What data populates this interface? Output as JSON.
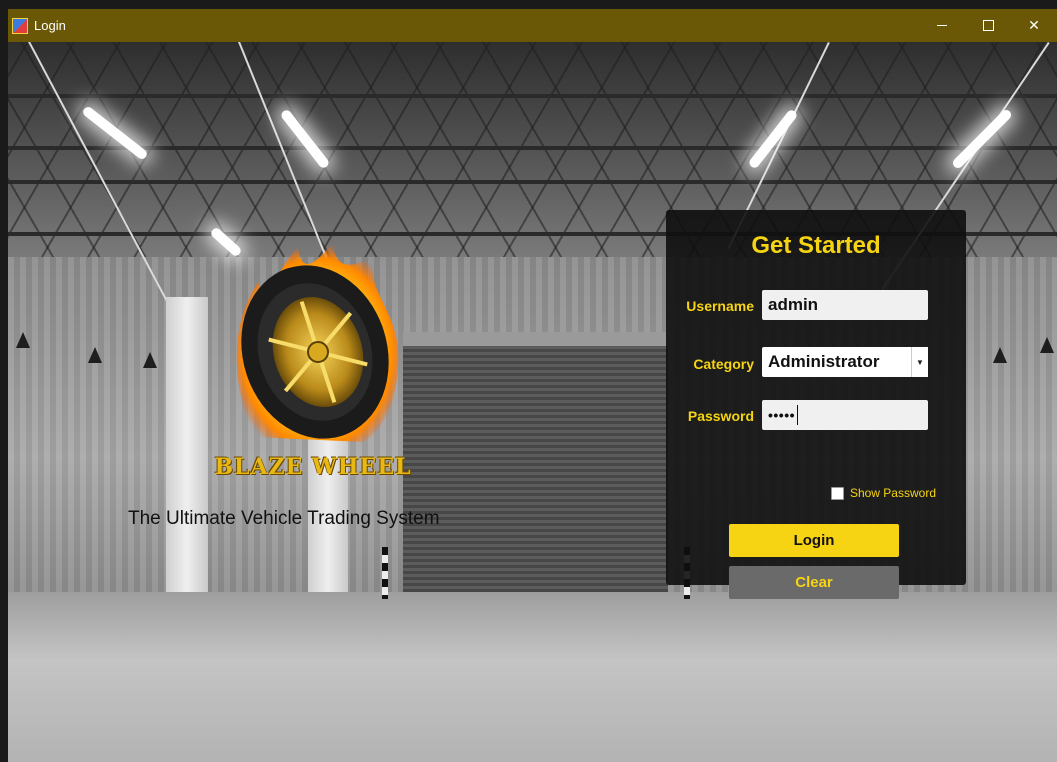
{
  "window": {
    "title": "Login",
    "controls": {
      "minimize": "minimize-icon",
      "maximize": "maximize-icon",
      "close": "close-icon"
    }
  },
  "brand": {
    "name": "BLAZE WHEEL",
    "tagline": "The Ultimate Vehicle Trading System"
  },
  "login": {
    "heading": "Get Started",
    "username_label": "Username",
    "username_value": "admin",
    "category_label": "Category",
    "category_value": "Administrator",
    "password_label": "Password",
    "password_mask": "•••••",
    "show_password_label": "Show Password",
    "show_password_checked": false,
    "login_button": "Login",
    "clear_button": "Clear"
  },
  "colors": {
    "titlebar": "#6b5806",
    "accent": "#f6d413",
    "panel": "#0e0e0e",
    "clear_button": "#6a6a6a"
  }
}
